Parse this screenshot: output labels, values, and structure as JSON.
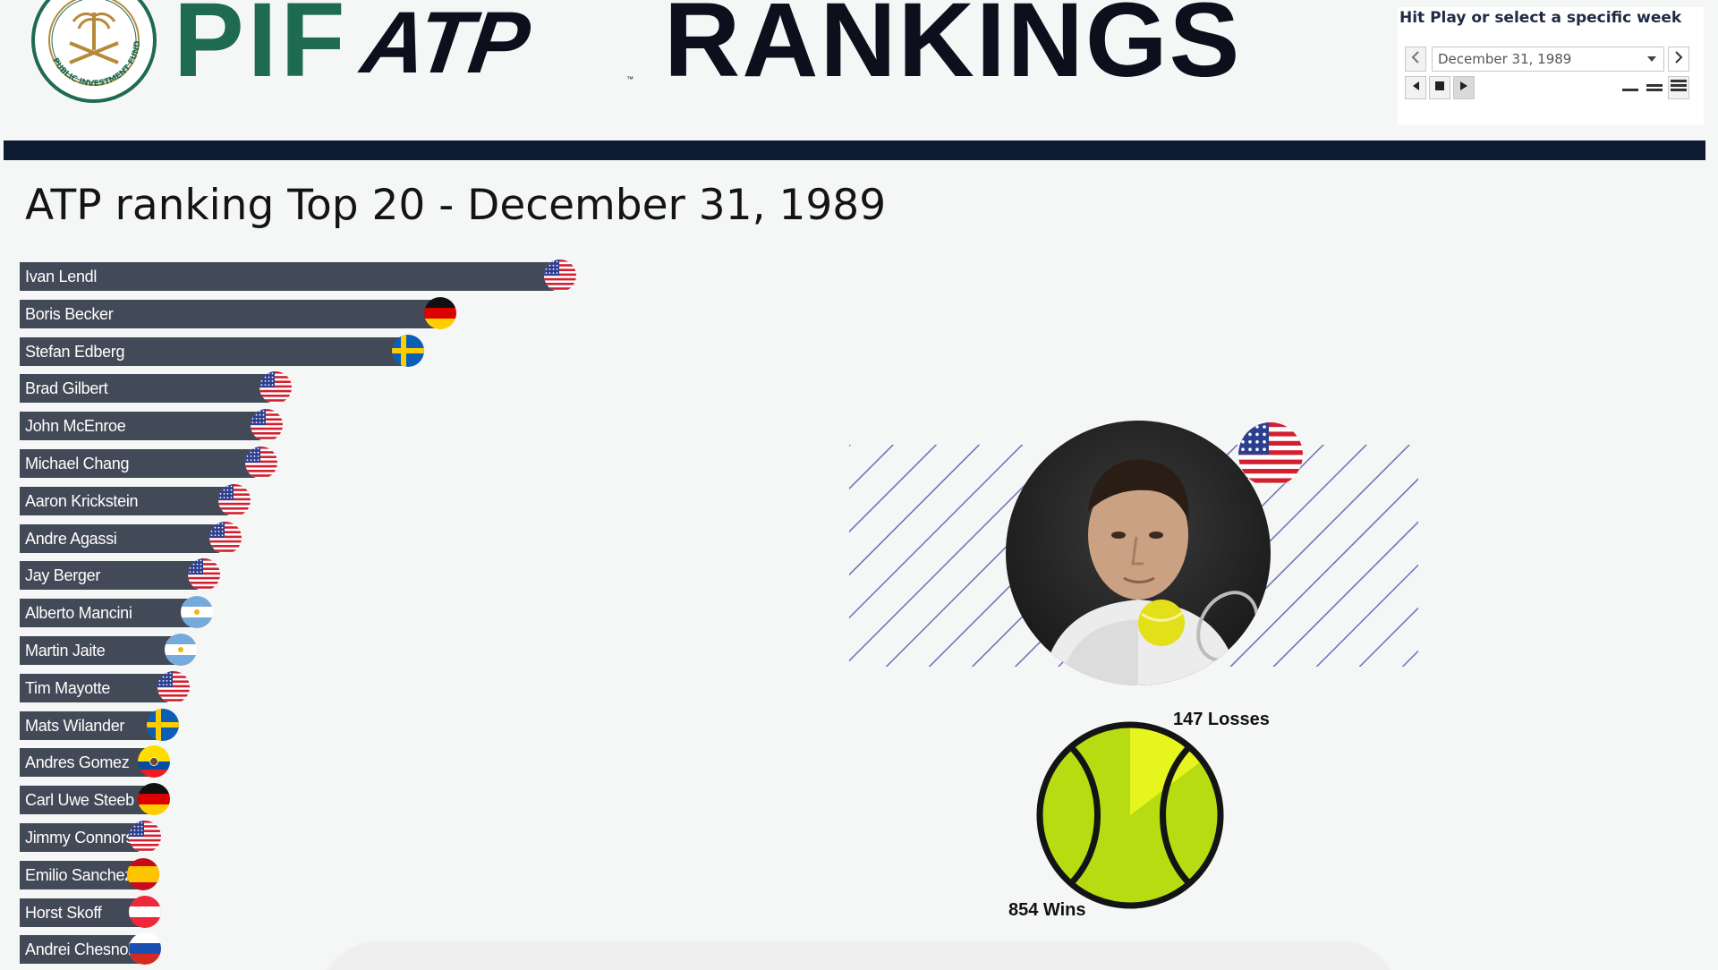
{
  "header": {
    "seal_text": "PUBLIC INVESTMENT FUND",
    "brand_pif": "PIF",
    "brand_atp": "ATP",
    "brand_tm": "™",
    "brand_rankings": "RANKINGS",
    "colors": {
      "pif_green": "#1f6b52",
      "navy": "#0e1a31"
    }
  },
  "controls": {
    "heading": "Hit Play or select a specific week",
    "selected_week": "December 31, 1989",
    "buttons": [
      "chevron-left-icon",
      "chevron-right-icon",
      "step-back-icon",
      "stop-icon",
      "play-icon",
      "view-compact-icon",
      "view-normal-icon",
      "view-list-icon"
    ]
  },
  "title": "ATP ranking Top 20 - December 31, 1989",
  "rankings": [
    {
      "name": "Ivan Lendl",
      "country": "USA"
    },
    {
      "name": "Boris Becker",
      "country": "GER"
    },
    {
      "name": "Stefan Edberg",
      "country": "SWE"
    },
    {
      "name": "Brad Gilbert",
      "country": "USA"
    },
    {
      "name": "John McEnroe",
      "country": "USA"
    },
    {
      "name": "Michael Chang",
      "country": "USA"
    },
    {
      "name": "Aaron Krickstein",
      "country": "USA"
    },
    {
      "name": "Andre Agassi",
      "country": "USA"
    },
    {
      "name": "Jay Berger",
      "country": "USA"
    },
    {
      "name": "Alberto Mancini",
      "country": "ARG"
    },
    {
      "name": "Martin Jaite",
      "country": "ARG"
    },
    {
      "name": "Tim Mayotte",
      "country": "USA"
    },
    {
      "name": "Mats Wilander",
      "country": "SWE"
    },
    {
      "name": "Andres Gomez",
      "country": "ECU"
    },
    {
      "name": "Carl Uwe Steeb",
      "country": "GER"
    },
    {
      "name": "Jimmy Connors",
      "country": "USA"
    },
    {
      "name": "Emilio Sanchez",
      "country": "ESP"
    },
    {
      "name": "Horst Skoff",
      "country": "AUT"
    },
    {
      "name": "Andrei Chesnokov",
      "country": "URS"
    }
  ],
  "player": {
    "country": "USA",
    "losses_label": "147 Losses",
    "wins_label": "854 Wins",
    "wins": 854,
    "losses": 147
  },
  "colors": {
    "bar": "#434a57",
    "ball": "#b7dc11",
    "ball_highlight": "#e6f51e",
    "hatch": "#6d6fb8"
  }
}
